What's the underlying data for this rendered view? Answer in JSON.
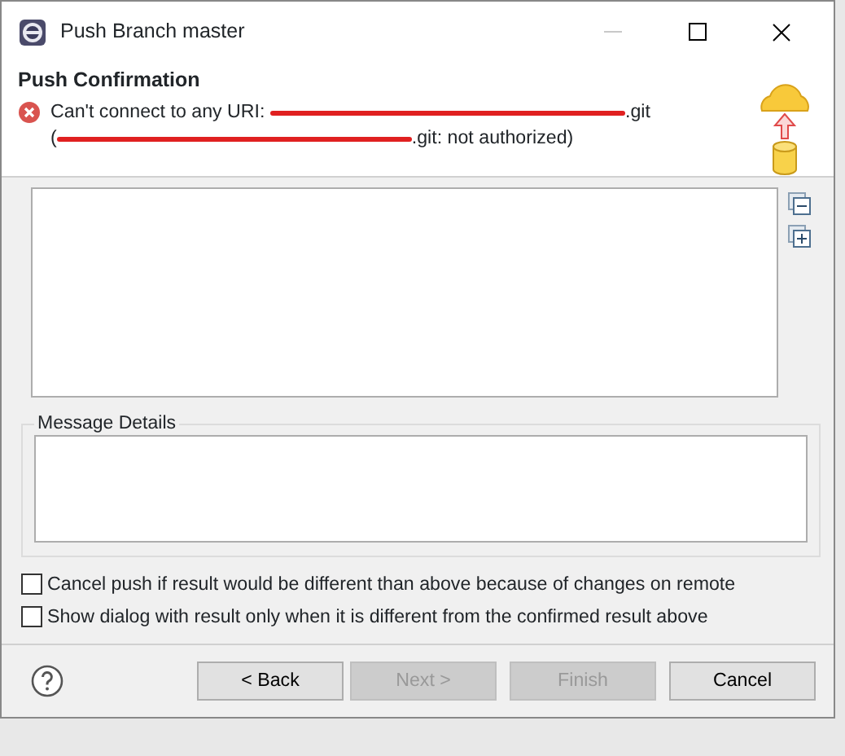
{
  "window": {
    "title": "Push Branch master"
  },
  "header": {
    "title": "Push Confirmation",
    "message": [
      {
        "kind": "text",
        "text": "Can't connect to any URI: "
      },
      {
        "kind": "redacted"
      },
      {
        "kind": "text",
        "text": ".git"
      },
      {
        "kind": "break"
      },
      {
        "kind": "text",
        "text": "("
      },
      {
        "kind": "redacted"
      },
      {
        "kind": "text",
        "text": ".git: not authorized)"
      }
    ]
  },
  "message_details": {
    "label": "Message Details"
  },
  "options": [
    {
      "label": "Cancel push if result would be different than above because of changes on remote",
      "checked": false
    },
    {
      "label": "Show dialog with result only when it is different from the confirmed result above",
      "checked": false
    }
  ],
  "buttons": [
    {
      "label": "< Back",
      "disabled": false
    },
    {
      "label": "Next >",
      "disabled": true
    },
    {
      "label": "Finish",
      "disabled": true
    },
    {
      "label": "Cancel",
      "disabled": false
    }
  ]
}
